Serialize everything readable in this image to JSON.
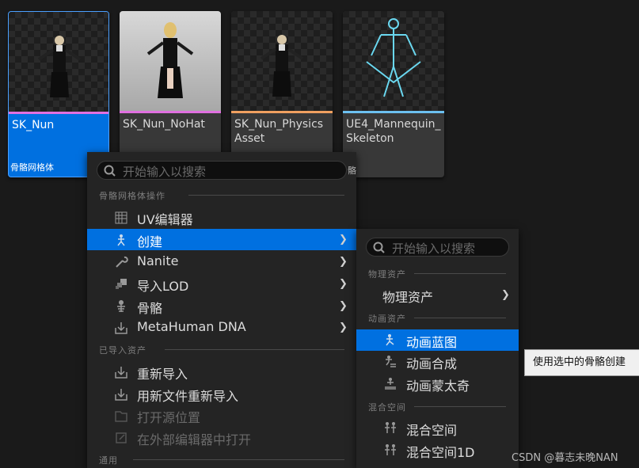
{
  "assets": [
    {
      "name": "SK_Nun",
      "type_label": "骨骼网格体",
      "color": "#e070e0"
    },
    {
      "name": "SK_Nun_NoHat",
      "type_label": "",
      "color": "#e070e0"
    },
    {
      "name": "SK_Nun_Physics Asset",
      "type_label": "",
      "color": "#f0a060"
    },
    {
      "name": "UE4_Mannequin_ Skeleton",
      "type_label": "骼",
      "color": "#6cc0f0"
    }
  ],
  "main_menu": {
    "search_placeholder": "开始输入以搜索",
    "section_ops": "骨骼网格体操作",
    "items_ops": [
      {
        "label": "UV编辑器",
        "icon": "grid-icon"
      },
      {
        "label": "创建",
        "icon": "animation-icon"
      },
      {
        "label": "Nanite",
        "icon": "wrench-icon"
      },
      {
        "label": "导入LOD",
        "icon": "lod-icon"
      },
      {
        "label": "骨骼",
        "icon": "skeleton-icon"
      },
      {
        "label": "MetaHuman DNA",
        "icon": "import-icon"
      }
    ],
    "section_imported": "已导入资产",
    "items_imported": [
      {
        "label": "重新导入",
        "icon": "import-icon"
      },
      {
        "label": "用新文件重新导入",
        "icon": "import-icon"
      },
      {
        "label": "打开源位置",
        "icon": "folder-icon"
      },
      {
        "label": "在外部编辑器中打开",
        "icon": "external-icon"
      }
    ],
    "section_common": "通用"
  },
  "sub_menu": {
    "search_placeholder": "开始输入以搜索",
    "section_physics": "物理资产",
    "item_physics": "物理资产",
    "section_anim": "动画资产",
    "items_anim": [
      {
        "label": "动画蓝图",
        "icon": "anim-blueprint-icon"
      },
      {
        "label": "动画合成",
        "icon": "anim-montage-icon"
      },
      {
        "label": "动画蒙太奇",
        "icon": "anim-composite-icon"
      }
    ],
    "section_blend": "混合空间",
    "items_blend": [
      {
        "label": "混合空间",
        "icon": "blendspace-icon"
      },
      {
        "label": "混合空间1D",
        "icon": "blendspace1d-icon"
      }
    ]
  },
  "tooltip": "使用选中的骨骼创建",
  "watermark": "CSDN @暮志未晚NAN",
  "colors": {
    "accent": "#0070e0",
    "menu_bg": "#242424"
  }
}
